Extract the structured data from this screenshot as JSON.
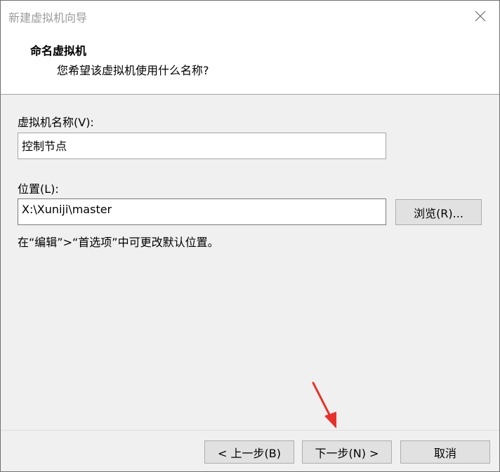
{
  "window": {
    "title": "新建虚拟机向导"
  },
  "header": {
    "title": "命名虚拟机",
    "subtitle": "您希望该虚拟机使用什么名称?"
  },
  "form": {
    "vm_name_label": "虚拟机名称(V):",
    "vm_name_value": "控制节点",
    "location_label": "位置(L):",
    "location_value": "X:\\Xuniji\\master",
    "browse_label": "浏览(R)...",
    "hint": "在“编辑”>“首选项”中可更改默认位置。"
  },
  "footer": {
    "back_label": "< 上一步(B)",
    "next_label": "下一步(N) >",
    "cancel_label": "取消"
  },
  "annotation": {
    "arrow_color": "#e8302a"
  }
}
